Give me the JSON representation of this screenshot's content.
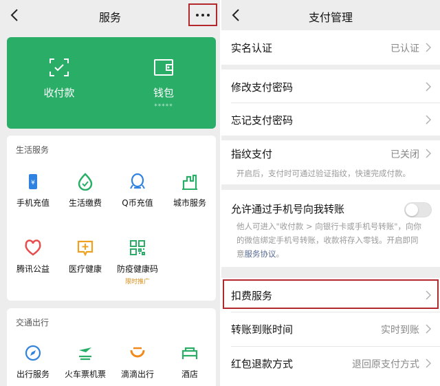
{
  "colors": {
    "accent_green": "#2aae67",
    "highlight_red": "#b3262b",
    "link_blue": "#576b95",
    "tag_orange": "#d98e1b"
  },
  "left": {
    "title": "服务",
    "pay_card": {
      "items": [
        {
          "label": "收付款",
          "icon": "scan-pay-icon"
        },
        {
          "label": "钱包",
          "sub": "*****",
          "icon": "wallet-icon"
        }
      ]
    },
    "life": {
      "title": "生活服务",
      "items": [
        {
          "label": "手机充值",
          "icon": "phone-recharge-icon"
        },
        {
          "label": "生活缴费",
          "icon": "utility-payment-icon"
        },
        {
          "label": "Q币充值",
          "icon": "qq-coin-icon"
        },
        {
          "label": "城市服务",
          "icon": "city-service-icon"
        },
        {
          "label": "腾讯公益",
          "icon": "charity-heart-icon"
        },
        {
          "label": "医疗健康",
          "icon": "medical-icon"
        },
        {
          "label": "防疫健康码",
          "tag": "限时推广",
          "icon": "health-code-icon"
        }
      ]
    },
    "transport": {
      "title": "交通出行",
      "items": [
        {
          "label": "出行服务",
          "icon": "travel-compass-icon"
        },
        {
          "label": "火车票机票",
          "icon": "train-plane-icon"
        },
        {
          "label": "滴滴出行",
          "icon": "didi-icon"
        },
        {
          "label": "酒店",
          "icon": "hotel-bed-icon"
        }
      ]
    }
  },
  "right": {
    "title": "支付管理",
    "rows": {
      "realname": {
        "label": "实名认证",
        "value": "已认证"
      },
      "change_pwd": {
        "label": "修改支付密码"
      },
      "forgot_pwd": {
        "label": "忘记支付密码"
      },
      "fingerprint": {
        "label": "指纹支付",
        "value": "已关闭",
        "desc": "开启后，支付时可通过验证指纹，快速完成付款。"
      },
      "phone_transfer": {
        "label": "允许通过手机号向我转账",
        "desc_l1": "他人可进入\"收付款 > 向银行卡或手机号转账\"，向你",
        "desc_l2": "的微信绑定手机号转账，收款将存入零钱。开启即同",
        "desc_l3_pre": "意",
        "desc_link": "服务协议",
        "desc_l3_post": "。"
      },
      "deduction": {
        "label": "扣费服务"
      },
      "arrival_time": {
        "label": "转账到账时间",
        "value": "实时到账"
      },
      "redpacket_refund": {
        "label": "红包退款方式",
        "value": "退回原支付方式"
      }
    }
  }
}
